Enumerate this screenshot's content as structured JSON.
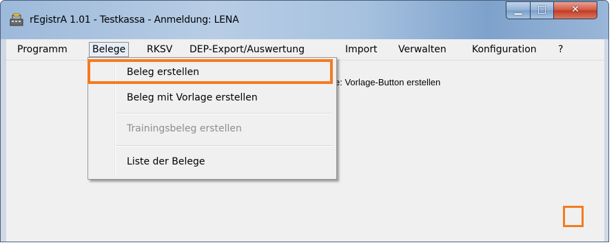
{
  "window": {
    "title": "rEgistrA 1.01 - Testkassa - Anmeldung: LENA",
    "icon": "cash-register-icon",
    "controls": {
      "minimize": "minimize-icon",
      "maximize": "maximize-icon",
      "close": "close-icon"
    }
  },
  "menubar": {
    "items": [
      "Programm",
      "Belege",
      "RKSV",
      "DEP-Export/Auswertung",
      "Import",
      "Verwalten",
      "Konfiguration",
      "?"
    ],
    "open_item": "Belege"
  },
  "dropdown": {
    "items": [
      {
        "label": "Beleg erstellen",
        "enabled": true,
        "highlighted": true
      },
      {
        "label": "Beleg mit Vorlage erstellen",
        "enabled": true
      },
      {
        "label": "Trainingsbeleg erstellen",
        "enabled": false
      },
      {
        "label": "Liste der Belege",
        "enabled": true
      }
    ]
  },
  "background_text": "e: Vorlage-Button erstellen",
  "colors": {
    "highlight": "#f57b20",
    "close_button": "#c23a22"
  }
}
